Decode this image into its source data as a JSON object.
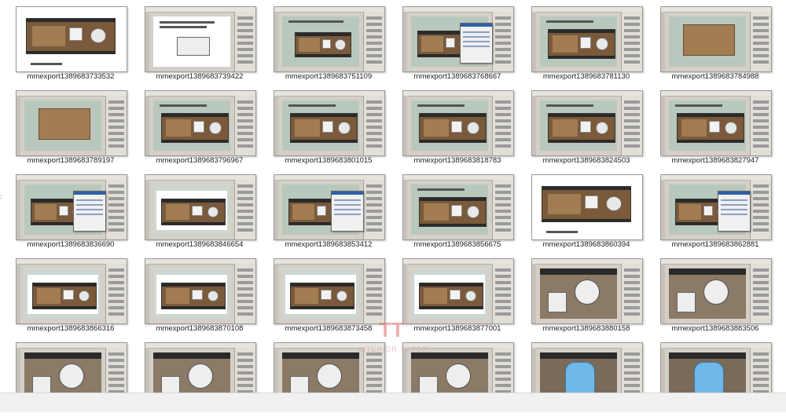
{
  "files": [
    {
      "name": "mmexport1389683733532",
      "style": "plan-white"
    },
    {
      "name": "mmexport1389683739422",
      "style": "ps-doc"
    },
    {
      "name": "mmexport1389683751109",
      "style": "ps-green"
    },
    {
      "name": "mmexport1389683768667",
      "style": "ps-dialog"
    },
    {
      "name": "mmexport1389683781130",
      "style": "ps-plan"
    },
    {
      "name": "mmexport1389683784988",
      "style": "ps-wood"
    },
    {
      "name": "mmexport1389683789197",
      "style": "ps-wood"
    },
    {
      "name": "mmexport1389683796967",
      "style": "ps-plan"
    },
    {
      "name": "mmexport1389683801015",
      "style": "ps-plan"
    },
    {
      "name": "mmexport1389683818783",
      "style": "ps-plan"
    },
    {
      "name": "mmexport1389683824503",
      "style": "ps-plan"
    },
    {
      "name": "mmexport1389683827947",
      "style": "ps-plan"
    },
    {
      "name": "mmexport1389683836690",
      "style": "ps-dialog"
    },
    {
      "name": "mmexport1389683846654",
      "style": "ps-plan-white"
    },
    {
      "name": "mmexport1389683853412",
      "style": "ps-dialog"
    },
    {
      "name": "mmexport1389683856675",
      "style": "ps-plan"
    },
    {
      "name": "mmexport1389683860394",
      "style": "plan-white"
    },
    {
      "name": "mmexport1389683862881",
      "style": "ps-dialog"
    },
    {
      "name": "mmexport1389683866316",
      "style": "ps-plan-white"
    },
    {
      "name": "mmexport1389683870108",
      "style": "ps-plan-white"
    },
    {
      "name": "mmexport1389683873458",
      "style": "ps-plan-white"
    },
    {
      "name": "mmexport1389683877001",
      "style": "ps-plan-white"
    },
    {
      "name": "mmexport1389683880158",
      "style": "ps-zoom"
    },
    {
      "name": "mmexport1389683883506",
      "style": "ps-zoom"
    },
    {
      "name": "",
      "style": "ps-zoom"
    },
    {
      "name": "",
      "style": "ps-zoom"
    },
    {
      "name": "",
      "style": "ps-zoom"
    },
    {
      "name": "",
      "style": "ps-zoom"
    },
    {
      "name": "",
      "style": "ps-tub"
    },
    {
      "name": "",
      "style": "ps-tub"
    }
  ],
  "watermark": {
    "logo": "TT",
    "text": "INTERIOR TUTOR"
  }
}
